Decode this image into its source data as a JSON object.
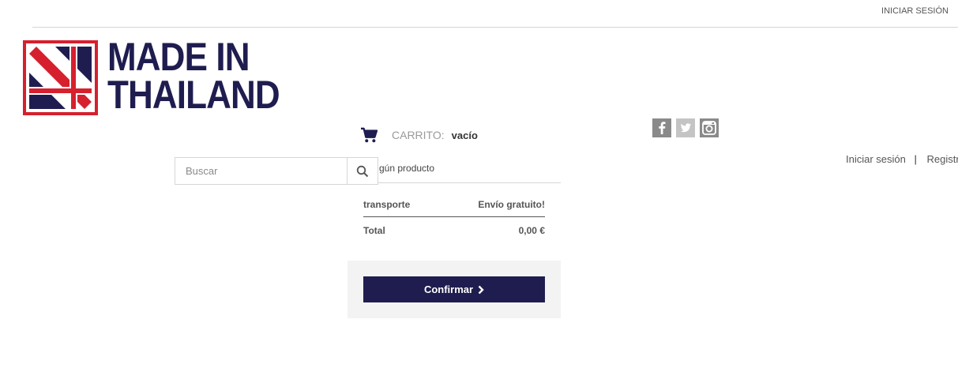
{
  "header": {
    "top_login_label": "INICIAR SESIÓN",
    "logo_line1": "MADE IN",
    "logo_line2": "THAILAND"
  },
  "cart": {
    "label": "CARRITO:",
    "status": "vacío",
    "empty_message": "gún producto"
  },
  "social": {
    "icons": [
      "facebook-icon",
      "twitter-icon",
      "instagram-icon"
    ]
  },
  "user_links": {
    "login": "Iniciar sesión",
    "separator": "|",
    "register": "Registro"
  },
  "search": {
    "placeholder": "Buscar"
  },
  "cart_dropdown": {
    "shipping_label": "transporte",
    "shipping_value": "Envío gratuito!",
    "total_label": "Total",
    "total_value": "0,00 €",
    "confirm_label": "Confirmar"
  },
  "colors": {
    "brand_navy": "#1f1d4f",
    "brand_red": "#d6202e"
  }
}
